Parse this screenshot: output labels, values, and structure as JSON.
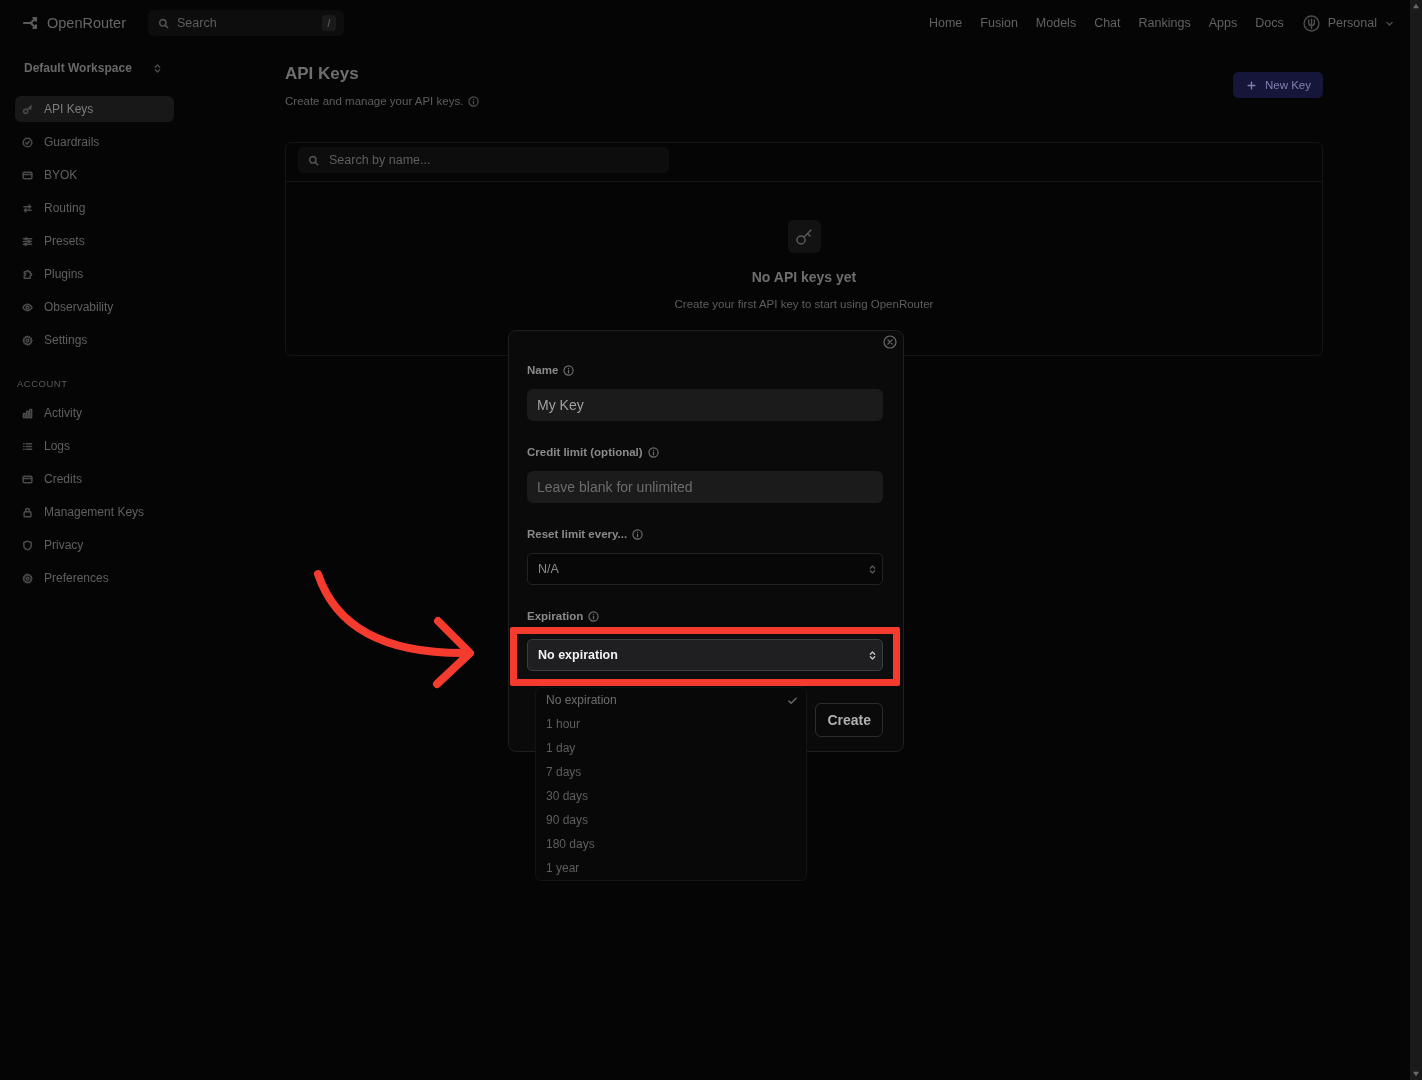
{
  "top_nav": {
    "brand": "OpenRouter",
    "search": {
      "placeholder": "Search",
      "shortcut": "/"
    },
    "links": [
      {
        "label": "Home"
      },
      {
        "label": "Fusion"
      },
      {
        "label": "Models"
      },
      {
        "label": "Chat"
      },
      {
        "label": "Rankings"
      },
      {
        "label": "Apps"
      },
      {
        "label": "Docs"
      }
    ],
    "account": {
      "label": "Personal"
    }
  },
  "sidebar": {
    "workspace": "Default Workspace",
    "sections": [
      {
        "items": [
          {
            "label": "API Keys",
            "selected": true
          },
          {
            "label": "Guardrails",
            "selected": false
          },
          {
            "label": "BYOK",
            "selected": false
          },
          {
            "label": "Routing",
            "selected": false
          },
          {
            "label": "Presets",
            "selected": false
          },
          {
            "label": "Plugins",
            "selected": false
          },
          {
            "label": "Observability",
            "selected": false
          },
          {
            "label": "Settings",
            "selected": false
          }
        ]
      },
      {
        "heading": "ACCOUNT",
        "items": [
          {
            "label": "Activity",
            "selected": false
          },
          {
            "label": "Logs",
            "selected": false
          },
          {
            "label": "Credits",
            "selected": false
          },
          {
            "label": "Management Keys",
            "selected": false
          },
          {
            "label": "Privacy",
            "selected": false
          },
          {
            "label": "Preferences",
            "selected": false
          }
        ]
      }
    ]
  },
  "main": {
    "title": "API Keys",
    "subtitle": "Create and manage your API keys.",
    "new_key_button": "New Key",
    "search": {
      "placeholder": "Search by name..."
    },
    "empty_state": {
      "title": "No API keys yet",
      "text": "Create your first API key to start using OpenRouter"
    }
  },
  "dialog": {
    "fields": [
      {
        "kind": "input",
        "label": "Name",
        "value": "My Key",
        "highlighted": false
      },
      {
        "kind": "input",
        "label": "Credit limit (optional)",
        "placeholder": "Leave blank for unlimited",
        "highlighted": false
      },
      {
        "kind": "select",
        "label": "Reset limit every...",
        "value": "N/A",
        "highlighted": false
      },
      {
        "kind": "select",
        "label": "Expiration",
        "value": "No expiration",
        "highlighted": true,
        "options": [
          {
            "label": "No expiration",
            "selected": true
          },
          {
            "label": "1 hour",
            "selected": false
          },
          {
            "label": "1 day",
            "selected": false
          },
          {
            "label": "7 days",
            "selected": false
          },
          {
            "label": "30 days",
            "selected": false
          },
          {
            "label": "90 days",
            "selected": false
          },
          {
            "label": "180 days",
            "selected": false
          },
          {
            "label": "1 year",
            "selected": false
          }
        ]
      }
    ],
    "create_button": "Create"
  }
}
